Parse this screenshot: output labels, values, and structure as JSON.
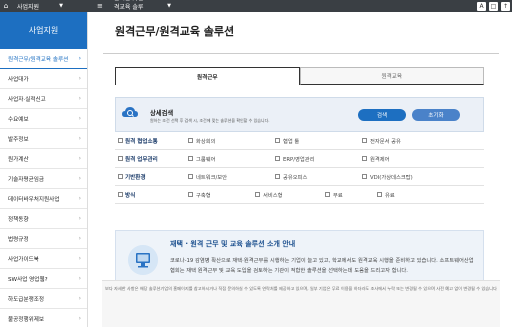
{
  "topbar": {
    "home_icon": "home-icon",
    "section": "사업지원",
    "page": "원격근무/원격교육 솔루션",
    "menu_icon": "menu-icon",
    "tools": [
      "A",
      "□",
      "↑"
    ]
  },
  "sidebar": {
    "title": "사업지원",
    "items": [
      {
        "label": "원격근무/원격교육 솔루션",
        "active": true
      },
      {
        "label": "사업대가",
        "active": false
      },
      {
        "label": "사업자·실적신고",
        "active": false
      },
      {
        "label": "수요예보",
        "active": false
      },
      {
        "label": "발주정보",
        "active": false
      },
      {
        "label": "원가계산",
        "active": false
      },
      {
        "label": "기술자평균임금",
        "active": false
      },
      {
        "label": "데이터바우처지원사업",
        "active": false
      },
      {
        "label": "정책동향",
        "active": false
      },
      {
        "label": "법령규정",
        "active": false
      },
      {
        "label": "사업가이드북",
        "active": false
      },
      {
        "label": "SW사업 영업웹?",
        "active": false
      },
      {
        "label": "하도급분쟁조정",
        "active": false
      },
      {
        "label": "불공정행위제보",
        "active": false
      }
    ]
  },
  "main": {
    "title": "원격근무/원격교육 솔루션",
    "tabs": [
      {
        "label": "원격근무",
        "active": true
      },
      {
        "label": "원격교육",
        "active": false
      }
    ],
    "filter": {
      "title": "상세검색",
      "description": "원하는 조건 선택 후 검색 시, 조건에 맞는 솔루션을 확인할 수 있습니다.",
      "search_label": "검색",
      "reset_label": "초기화",
      "rows": [
        {
          "label": "원격 협업소통",
          "options": [
            "화상회의",
            "협업 툴",
            "전자문서 공유"
          ]
        },
        {
          "label": "원격 업무관리",
          "options": [
            "그룹웨어",
            "ERP/영업관리",
            "원격제어"
          ]
        },
        {
          "label": "기반환경",
          "options": [
            "네트워크/보안",
            "공유오피스",
            "VDI(가상데스크탑)"
          ]
        },
        {
          "label": "방식",
          "options": [
            "구축형",
            "서비스형",
            "무료",
            "유료"
          ]
        }
      ]
    },
    "intro": {
      "title": "재택 · 원격 근무 및 교육 솔루션 소개 안내",
      "description": "코로나-19 감염병 확산으로 재택·원격근무를 시행하는 기업이 늘고 있고, 학교에서도 원격교육 시행을 준비하고 있습니다. 소프트웨어산업협회는 재택 원격근무 및 교육 도입을 검토하는 기관이 적합한 솔루션을 선택하는데 도움을 드리고자 합니다."
    },
    "notice": "보다 자세한 사항은 해당 솔루션기업의 홈페이지를 참고하시거나 직접 문의하실 수 있도록 연락처를 제공하고 있으며, 일부 기업은 무료 이용을 하더라도 조사에서 누락 또는 변경될 수 있으며 사전 예고 없이 변경될 수 있습니다"
  }
}
